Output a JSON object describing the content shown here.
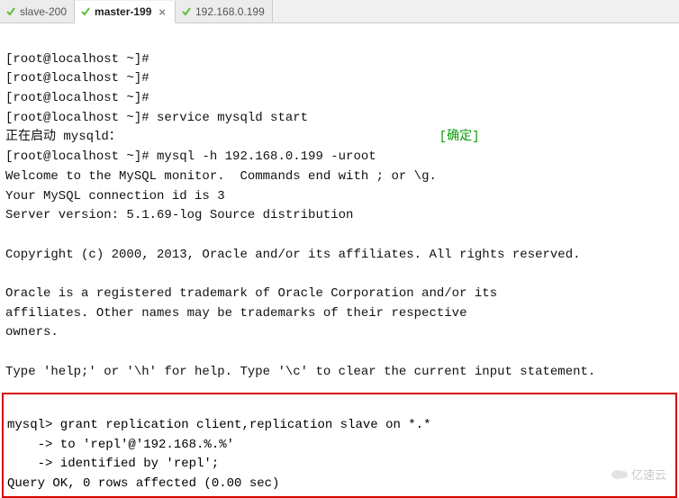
{
  "tabs": [
    {
      "label": "slave-200",
      "active": false,
      "closeable": false
    },
    {
      "label": "master-199",
      "active": true,
      "closeable": true
    },
    {
      "label": "192.168.0.199",
      "active": false,
      "closeable": false
    }
  ],
  "tab_close_glyph": "×",
  "terminal": {
    "lines": [
      "[root@localhost ~]#",
      "[root@localhost ~]#",
      "[root@localhost ~]#",
      "[root@localhost ~]# service mysqld start"
    ],
    "starting_prefix": "正在启动 mysqld：",
    "status_ok": "[确定]",
    "lines2": [
      "[root@localhost ~]# mysql -h 192.168.0.199 -uroot",
      "Welcome to the MySQL monitor.  Commands end with ; or \\g.",
      "Your MySQL connection id is 3",
      "Server version: 5.1.69-log Source distribution",
      "",
      "Copyright (c) 2000, 2013, Oracle and/or its affiliates. All rights reserved.",
      "",
      "Oracle is a registered trademark of Oracle Corporation and/or its",
      "affiliates. Other names may be trademarks of their respective",
      "owners.",
      "",
      "Type 'help;' or '\\h' for help. Type '\\c' to clear the current input statement.",
      ""
    ],
    "box_lines": [
      "mysql> grant replication client,replication slave on *.*",
      "    -> to 'repl'@'192.168.%.%'",
      "    -> identified by 'repl';",
      "Query OK, 0 rows affected (0.00 sec)"
    ]
  },
  "starting_pad": "                                          ",
  "watermark": "亿速云"
}
